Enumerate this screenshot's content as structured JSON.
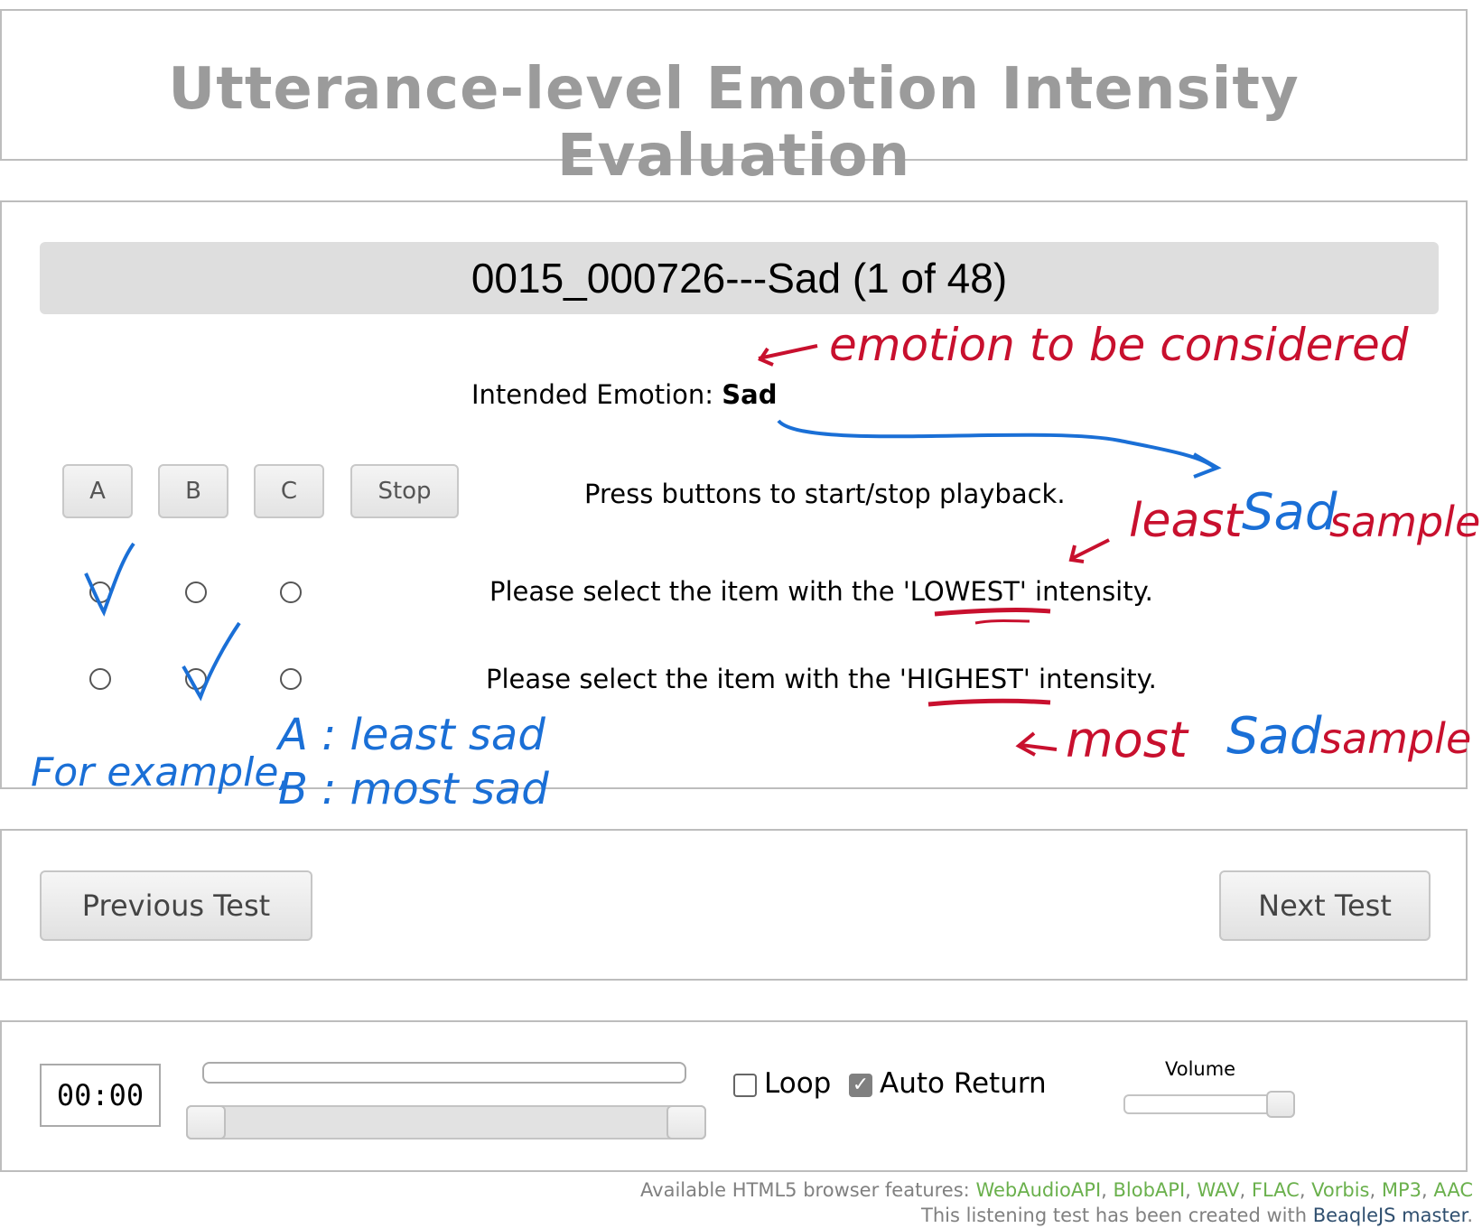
{
  "header": {
    "title": "Utterance-level Emotion Intensity Evaluation"
  },
  "test": {
    "title": "0015_000726---Sad (1 of 48)",
    "emotion_label": "Intended Emotion:",
    "emotion_value": "Sad",
    "play_buttons": [
      {
        "label": "A"
      },
      {
        "label": "B"
      },
      {
        "label": "C"
      },
      {
        "label": "Stop"
      }
    ],
    "play_instruction": "Press buttons to start/stop playback.",
    "lowest_instruction_pre": "Please select the item with the ",
    "lowest_keyword": "'LOWEST'",
    "lowest_instruction_post": " intensity.",
    "highest_instruction_pre": "Please select the item with the ",
    "highest_keyword": "'HIGHEST'",
    "highest_instruction_post": " intensity."
  },
  "navigation": {
    "previous_label": "Previous Test",
    "next_label": "Next Test"
  },
  "player": {
    "time": "00:00",
    "loop_label": "Loop",
    "loop_checked": false,
    "auto_return_label": "Auto Return",
    "auto_return_checked": true,
    "volume_label": "Volume",
    "volume_level": 1.0
  },
  "footer": {
    "features_label": "Available HTML5 browser features: ",
    "features": [
      "WebAudioAPI",
      "BlobAPI",
      "WAV",
      "FLAC",
      "Vorbis",
      "MP3",
      "AAC"
    ],
    "credit_pre": "This listening test has been created with ",
    "credit_link": "BeaqleJS master",
    "credit_post": "."
  },
  "annotations": {
    "emotion_note": "emotion to be considered",
    "least_note_1": "least",
    "least_note_2": "Sad",
    "least_note_3": "sample",
    "most_note_1": "most",
    "most_note_2": "Sad",
    "most_note_3": "sample",
    "example_label": "For example,",
    "example_a": "A : least sad",
    "example_b": "B : most sad",
    "colors": {
      "red": "#c8102e",
      "blue": "#1a6fd6"
    }
  }
}
